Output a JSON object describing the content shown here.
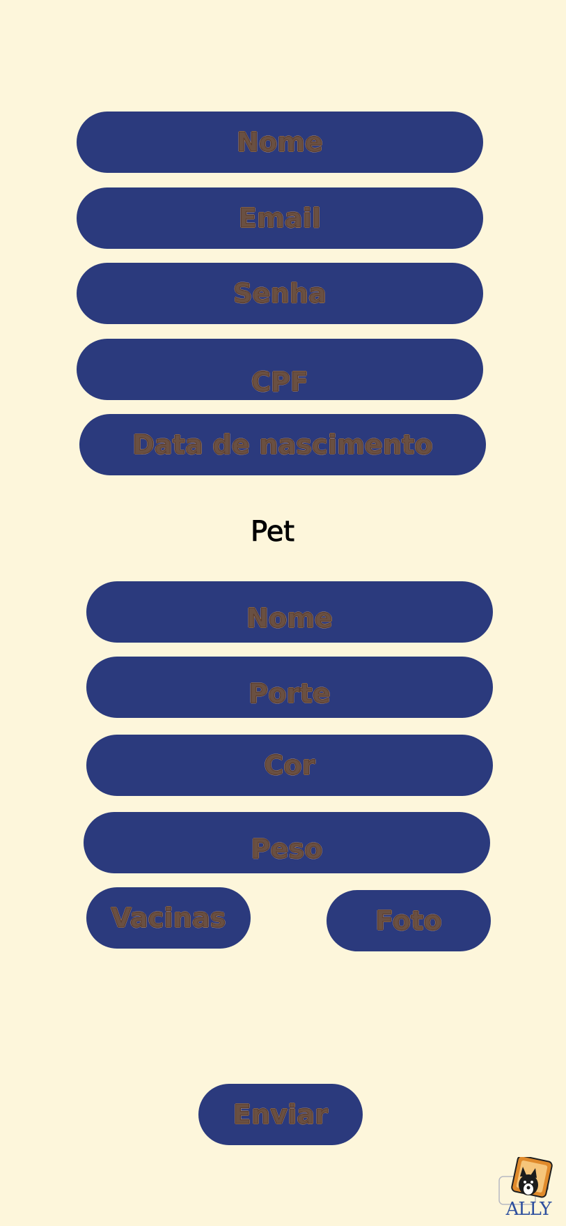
{
  "owner_form": {
    "name_label": "Nome",
    "email_label": "Email",
    "password_label": "Senha",
    "cpf_label": "CPF",
    "birthdate_label": "Data de nascimento"
  },
  "pet_section": {
    "title": "Pet",
    "name_label": "Nome",
    "size_label": "Porte",
    "color_label": "Cor",
    "weight_label": "Peso",
    "vaccines_label": "Vacinas",
    "photo_label": "Foto"
  },
  "submit_label": "Enviar",
  "brand": {
    "logo_text": "ALLY",
    "primary_color": "#2B3A7D",
    "background_color": "#FDF6DB",
    "text_color": "#6A5042"
  }
}
